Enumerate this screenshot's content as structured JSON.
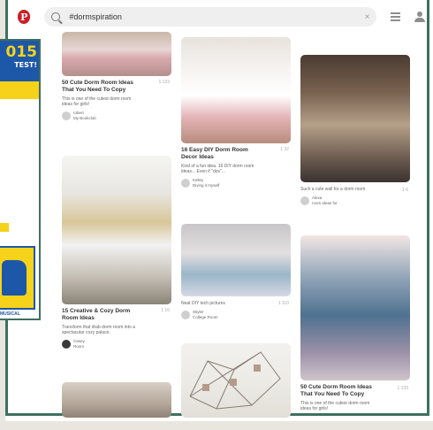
{
  "search": {
    "query": "#dormspiration",
    "clear_glyph": "×"
  },
  "pins": [
    {
      "title": "50 Cute Dorm Room Ideas That You Need To Copy",
      "desc": "This is one of the cutest dorm room ideas for girls!",
      "meta": "1  133",
      "pinner": "robert",
      "board": "My Bookclub"
    },
    {
      "title": "15 Creative & Cozy Dorm Room Ideas",
      "desc": "Transform that drab dorm room into a spectacular cozy palace.",
      "meta": "1  10",
      "pinner": "Casey",
      "board": "Room"
    },
    {
      "title": "16 Easy DIY Dorm Room Decor Ideas",
      "desc": "Kind of a fun idea. 16 DIY dorm room ideas... Even if \"dos\"...",
      "meta": "1  32",
      "pinner": "Kelley",
      "board": "Diving it myself"
    },
    {
      "title": "",
      "desc": "Neat DIY tech pictures",
      "meta": "1  110",
      "pinner": "Skyler",
      "board": "College Room"
    },
    {
      "title": "",
      "desc": "Such a cute wall for a dorm room",
      "meta": "1  6",
      "pinner": "Alexa",
      "board": "room ideas for"
    },
    {
      "title": "50 Cute Dorm Room Ideas That You Need To Copy",
      "desc": "This is one of the cutest dorm room ideas for girls!",
      "meta": "1  133",
      "pinner": "",
      "board": ""
    }
  ],
  "flyer": {
    "year": "015",
    "sub": "TEST!",
    "foot": "MUSICAL"
  },
  "colors": {
    "brand": "#cb1f27",
    "frame": "#3f6f5f",
    "flyer_blue": "#1d57a8",
    "flyer_yellow": "#f7d21a"
  }
}
